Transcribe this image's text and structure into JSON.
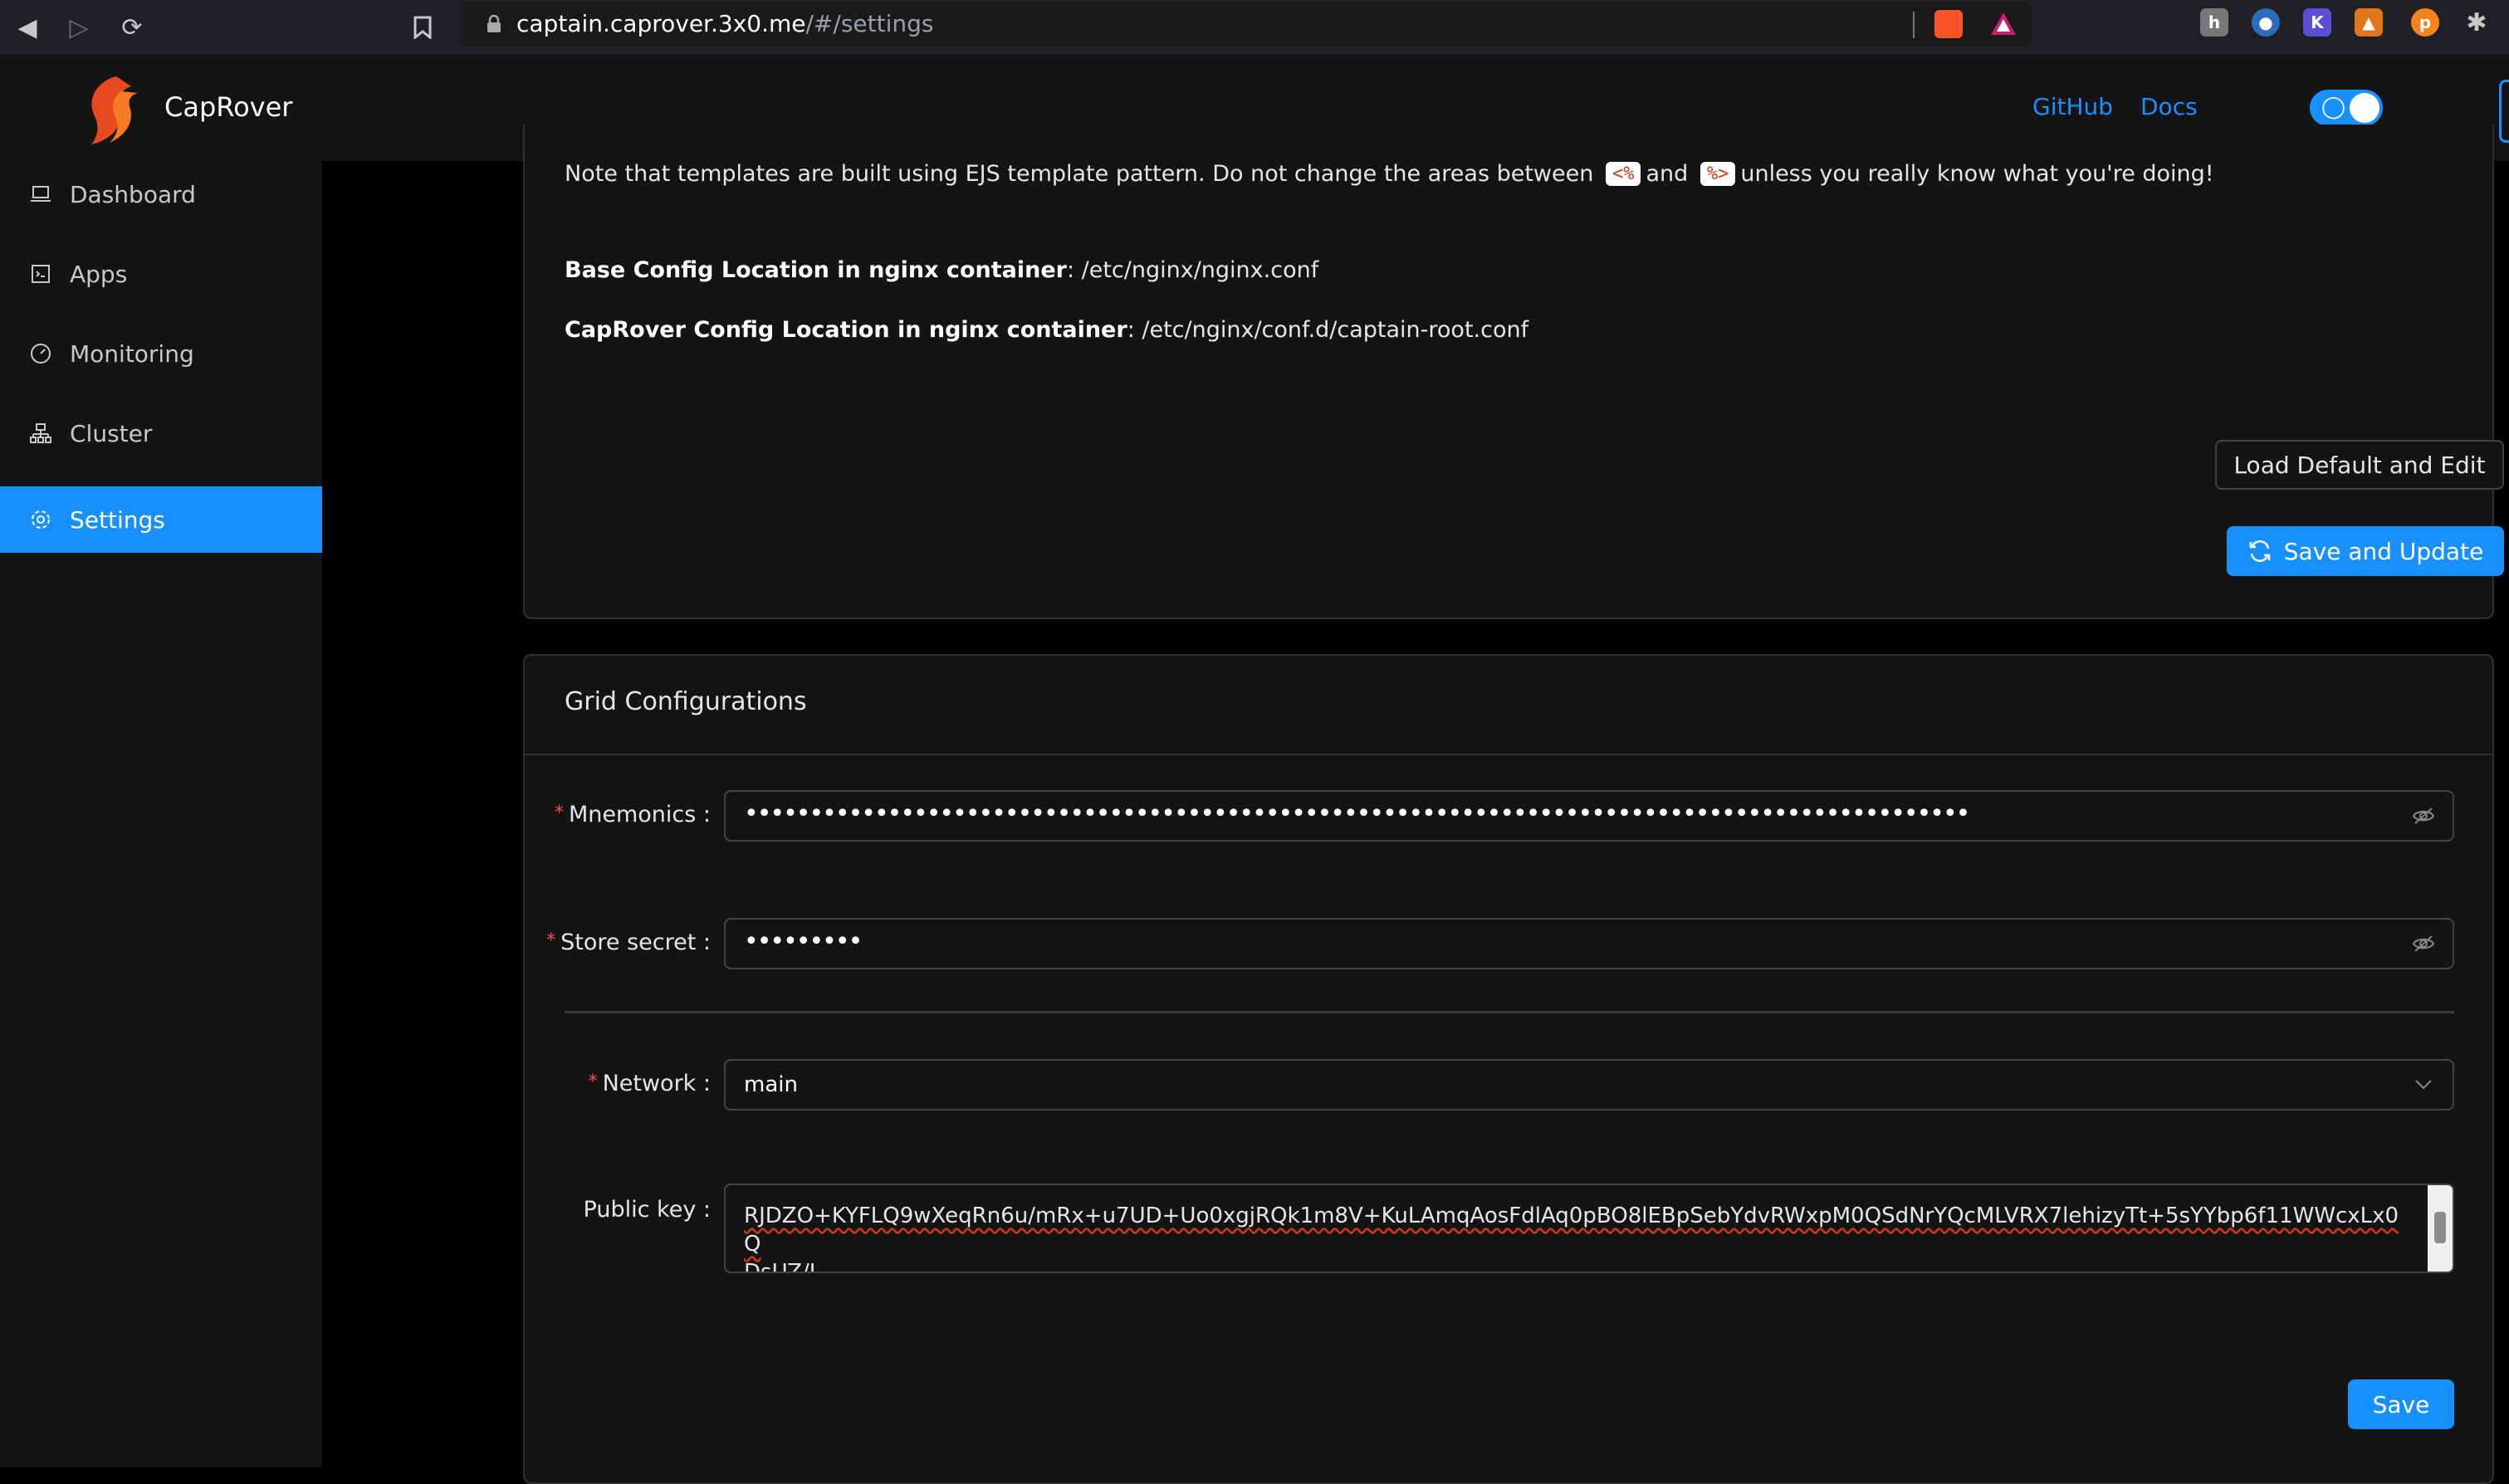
{
  "browser": {
    "url_host": "captain.caprover.3x0.me",
    "url_path": "/#/settings"
  },
  "header": {
    "brand": "CapRover",
    "links": [
      "GitHub",
      "Docs"
    ]
  },
  "sidebar": {
    "items": [
      {
        "label": "Dashboard",
        "icon": "laptop-icon"
      },
      {
        "label": "Apps",
        "icon": "code-icon"
      },
      {
        "label": "Monitoring",
        "icon": "dashboard-icon"
      },
      {
        "label": "Cluster",
        "icon": "cluster-icon"
      },
      {
        "label": "Settings",
        "icon": "gear-icon",
        "active": true
      }
    ]
  },
  "nginx_card": {
    "note_before": "Note that templates are built using EJS template pattern. Do not change the areas between",
    "tag_open": "<%",
    "note_and": "and",
    "tag_close": "%>",
    "note_after": "unless you really know what you're doing!",
    "base_label": "Base Config Location in nginx container",
    "base_value": ": /etc/nginx/nginx.conf",
    "captain_label": "CapRover Config Location in nginx container",
    "captain_value": ": /etc/nginx/conf.d/captain-root.conf",
    "load_default_label": "Load Default and Edit",
    "save_update_label": "Save and Update"
  },
  "grid_card": {
    "title": "Grid Configurations",
    "mnemonics_label": "Mnemonics",
    "mnemonics_value": "••••••••••••••••••••••••••••••••••••••••••••••••••••••••••••••••••••••••••••••••••••••••••••••",
    "store_secret_label": "Store secret",
    "store_secret_value": "•••••••••",
    "network_label": "Network",
    "network_value": "main",
    "public_key_label": "Public key",
    "public_key_line1": "RJDZO+KYFLQ9wXeqRn6u/mRx+u7UD+Uo0xgjRQk1m8V+KuLAmqAosFdlAq0pBO8lEBpSebYdvRWxpM0QSdNrYQcMLVRX7lehizyTt+5sYYbp6f11WWcxLx0Q",
    "public_key_line2": "DsUZ/J",
    "save_label": "Save"
  },
  "colors": {
    "accent": "#1890ff",
    "required": "#ff4d4f",
    "background": "#000000",
    "panel": "#141414"
  }
}
